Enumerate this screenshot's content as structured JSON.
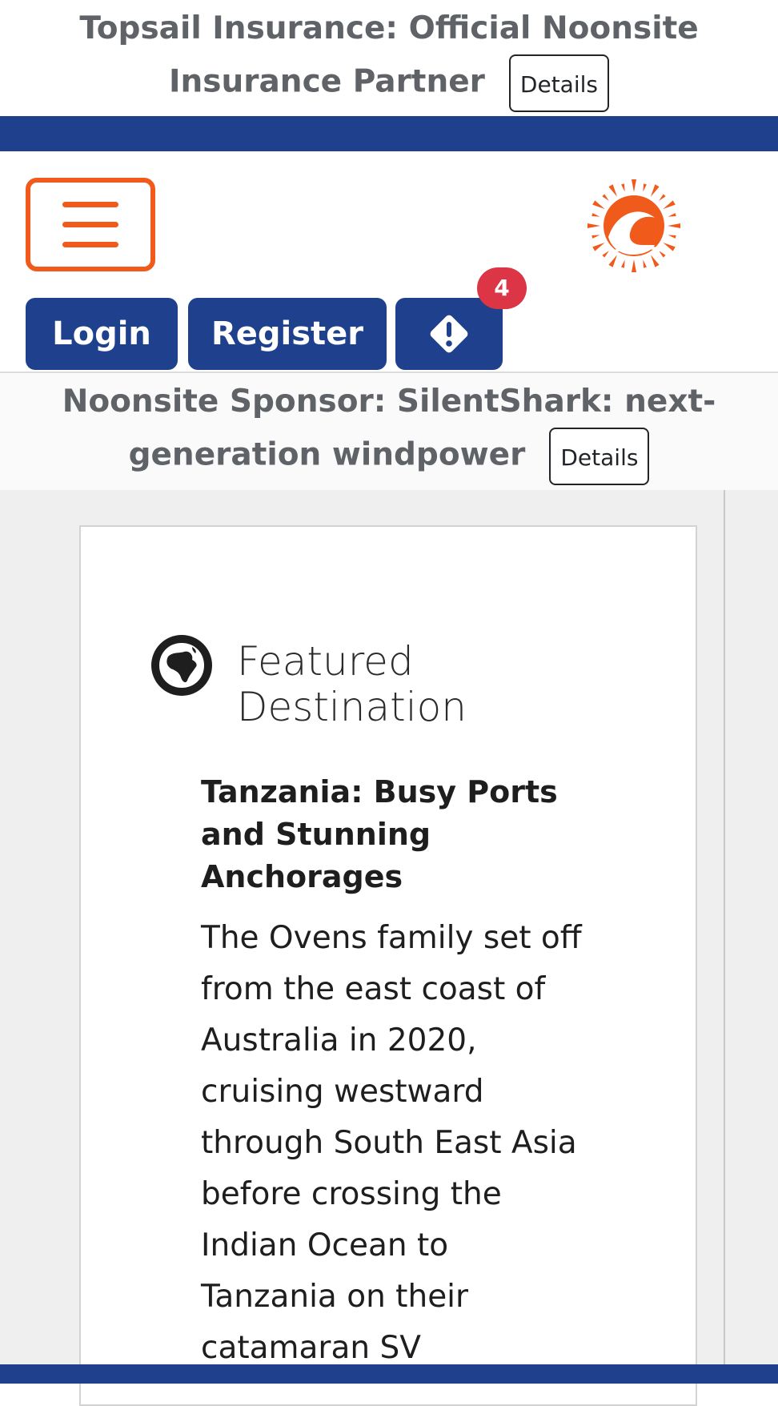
{
  "top_banner": {
    "text": "Topsail Insurance: Official Noonsite Insurance Partner",
    "details_label": "Details"
  },
  "header": {
    "menu_icon": "hamburger-menu-icon",
    "logo_icon": "sun-wave-logo",
    "login_label": "Login",
    "register_label": "Register",
    "alerts_icon": "warning-diamond-icon",
    "alerts_count": "4"
  },
  "sponsor_bar": {
    "text": "Noonsite Sponsor: SilentShark: next-generation windpower",
    "details_label": "Details"
  },
  "featured": {
    "icon": "globe-africa-icon",
    "label": "Featured Destination",
    "title": "Tanzania: Busy Ports and Stunning Anchorages",
    "body": "The Ovens family set off from the east coast of Australia in 2020, cruising westward through South East Asia before crossing the Indian Ocean to Tanzania on their catamaran SV"
  },
  "colors": {
    "brand_blue": "#1f418d",
    "brand_orange": "#f05a1a",
    "badge_red": "#dc3545",
    "banner_text_gray": "#5f6368",
    "page_background": "#efefef"
  }
}
